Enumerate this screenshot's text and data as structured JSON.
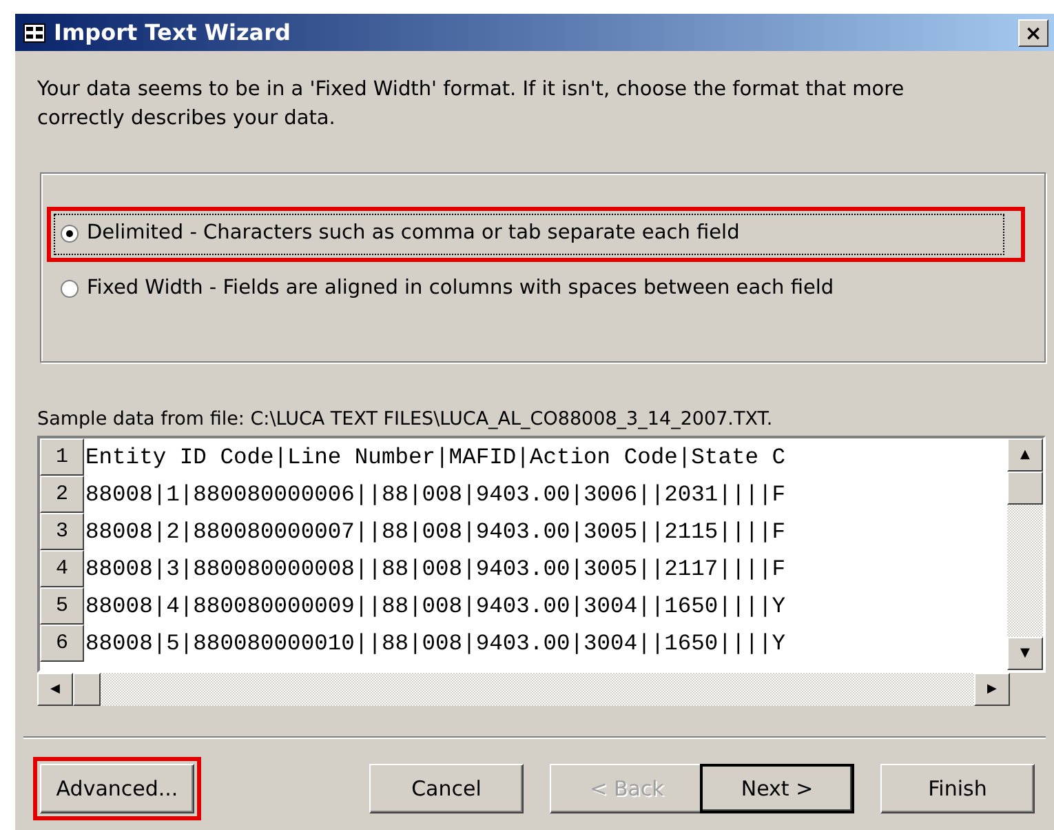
{
  "window": {
    "title": "Import Text Wizard",
    "close": "×"
  },
  "intro": "Your data seems to be in a 'Fixed Width' format. If it isn't, choose the format that more correctly describes your data.",
  "format_options": [
    {
      "label": "Delimited - Characters such as comma or tab separate each field",
      "selected": true,
      "focused": true,
      "highlighted": true
    },
    {
      "label": "Fixed Width - Fields are aligned in columns with spaces between each field",
      "selected": false,
      "focused": false,
      "highlighted": false
    }
  ],
  "sample": {
    "caption": "Sample data from file: C:\\LUCA TEXT FILES\\LUCA_AL_CO88008_3_14_2007.TXT.",
    "rows": [
      {
        "number": "1",
        "text": "Entity ID Code|Line Number|MAFID|Action Code|State C"
      },
      {
        "number": "2",
        "text": "88008|1|880080000006||88|008|9403.00|3006||2031||||F"
      },
      {
        "number": "3",
        "text": "88008|2|880080000007||88|008|9403.00|3005||2115||||F"
      },
      {
        "number": "4",
        "text": "88008|3|880080000008||88|008|9403.00|3005||2117||||F"
      },
      {
        "number": "5",
        "text": "88008|4|880080000009||88|008|9403.00|3004||1650||||Y"
      },
      {
        "number": "6",
        "text": "88008|5|880080000010||88|008|9403.00|3004||1650||||Y"
      }
    ],
    "scroll_up": "▲",
    "scroll_down": "▼",
    "scroll_left": "◀",
    "scroll_right": "▶"
  },
  "buttons": [
    {
      "label": "Advanced...",
      "kind": "left",
      "disabled": false,
      "default": false,
      "highlighted": true
    },
    {
      "label": "Cancel",
      "kind": "right",
      "disabled": false,
      "default": false,
      "highlighted": false
    },
    {
      "label": "< Back",
      "kind": "joined",
      "disabled": true,
      "default": false,
      "highlighted": false
    },
    {
      "label": "Next >",
      "kind": "joined",
      "disabled": false,
      "default": true,
      "highlighted": false
    },
    {
      "label": "Finish",
      "kind": "right",
      "disabled": false,
      "default": false,
      "highlighted": false
    }
  ]
}
